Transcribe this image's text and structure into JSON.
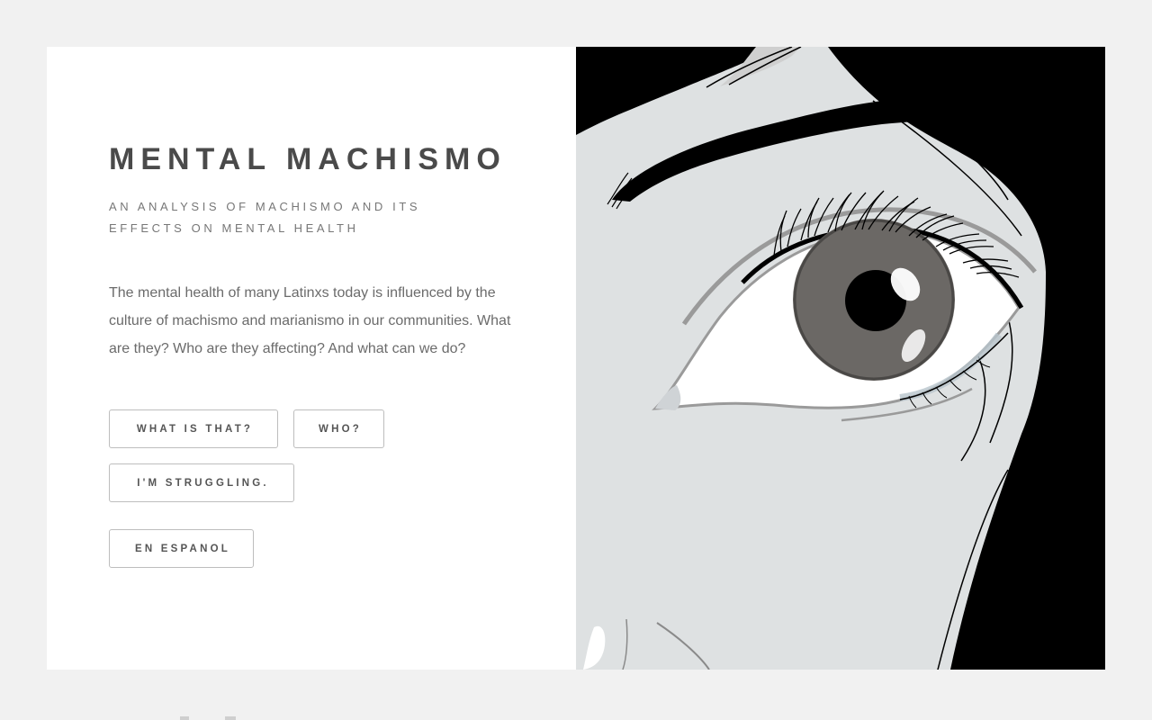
{
  "hero": {
    "title": "MENTAL MACHISMO",
    "subtitle": "AN ANALYSIS OF MACHISMO AND ITS EFFECTS ON MENTAL HEALTH",
    "description": "The mental health of many Latinxs today is influenced by the culture of machismo and marianismo in our communities. What are they? Who are they affecting? And what can we do?",
    "buttons": {
      "what": "WHAT IS THAT?",
      "who": "WHO?",
      "struggling": "I'M STRUGGLING.",
      "espanol": "EN ESPANOL"
    }
  },
  "illustration": {
    "subject": "eye-illustration",
    "colors": {
      "skin": "#dee1e2",
      "hair": "#000000",
      "iris": "#6b6865",
      "pupil": "#000000",
      "sclera": "#ffffff"
    }
  },
  "colors": {
    "page_background": "#f1f1f1",
    "card_background": "#ffffff",
    "title_text": "#4a4a4a",
    "body_text": "#6b6b6b",
    "button_border": "#bdbdbd"
  }
}
